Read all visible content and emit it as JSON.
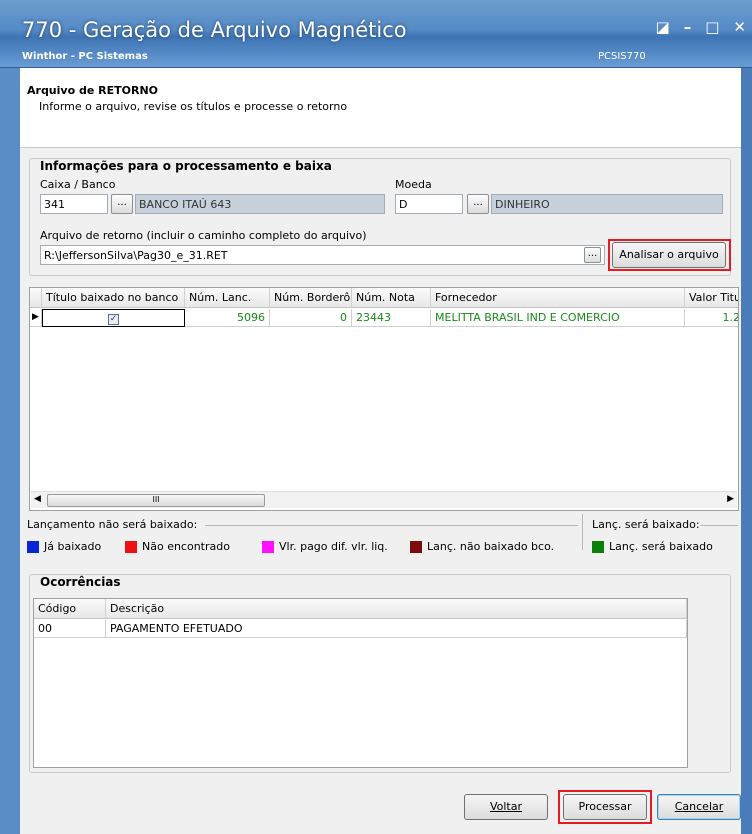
{
  "window": {
    "title": "770 - Geração de Arquivo Magnético",
    "subtitle": "Winthor - PC Sistemas",
    "code": "PCSIS770",
    "controls": {
      "restore": "◪",
      "minimize": "–",
      "maximize": "□",
      "close": "✕"
    }
  },
  "header": {
    "title": "Arquivo de RETORNO",
    "subtitle": "Informe o arquivo, revise os títulos e processe o retorno"
  },
  "info_panel": {
    "title": "Informações para o processamento e baixa",
    "caixa_banco_label": "Caixa / Banco",
    "caixa_banco_value": "341",
    "banco_name": "BANCO ITAÚ 643",
    "moeda_label": "Moeda",
    "moeda_value": "D",
    "moeda_name": "DINHEIRO",
    "arquivo_label": "Arquivo de retorno (incluir o caminho completo do arquivo)",
    "arquivo_value": "R:\\JeffersonSilva\\Pag30_e_31.RET",
    "ellipsis": "...",
    "analisar_button": "Analisar o arquivo"
  },
  "grid": {
    "columns": [
      "Título baixado no banco",
      "Núm. Lanc.",
      "Núm. Borderô",
      "Núm. Nota",
      "Fornecedor",
      "Valor Titu"
    ],
    "rows": [
      {
        "checked": true,
        "num_lanc": "5096",
        "num_bordero": "0",
        "num_nota": "23443",
        "fornecedor": "MELITTA BRASIL IND E COMERCIO",
        "valor": "1.2"
      }
    ],
    "scroll_grip": "III",
    "row_marker": "▶"
  },
  "legend": {
    "nao_baixado_label": "Lançamento não será baixado:",
    "sera_baixado_label": "Lanç. será baixado:",
    "items": [
      {
        "label": "Já baixado",
        "color": "#0b25d6"
      },
      {
        "label": "Não encontrado",
        "color": "#ee1111"
      },
      {
        "label": "Vlr. pago dif. vlr. liq.",
        "color": "#ff11ff"
      },
      {
        "label": "Lanç. não baixado bco.",
        "color": "#7d0a0a"
      },
      {
        "label": "Lanç. será baixado",
        "color": "#0a800a"
      }
    ]
  },
  "ocorrencias": {
    "title": "Ocorrências",
    "columns": [
      "Código",
      "Descrição"
    ],
    "rows": [
      {
        "codigo": "00",
        "descricao": "PAGAMENTO EFETUADO"
      }
    ]
  },
  "footer": {
    "voltar": "Voltar",
    "processar": "Processar",
    "cancelar": "Cancelar"
  }
}
